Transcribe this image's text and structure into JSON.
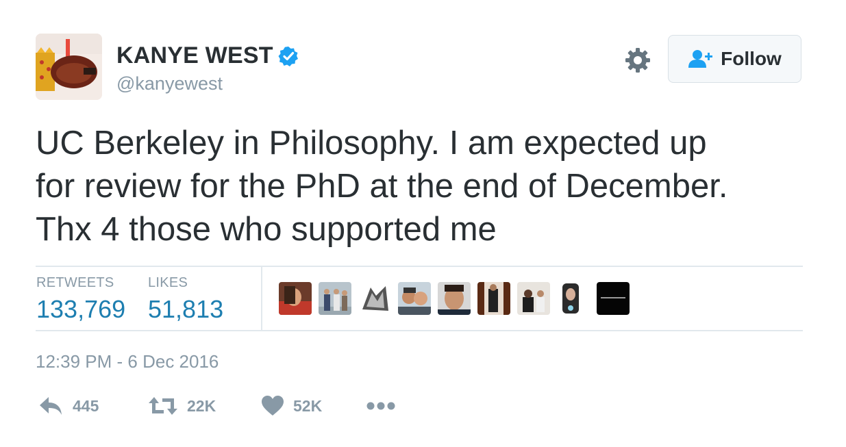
{
  "user": {
    "name": "KANYE WEST",
    "handle": "@kanyewest"
  },
  "header": {
    "follow_label": "Follow"
  },
  "tweet": {
    "lines": [
      "UC Berkeley in Philosophy. I am expected up",
      "for review for the PhD at the end of December.",
      "Thx 4 those who supported me"
    ]
  },
  "stats": {
    "retweets_label": "RETWEETS",
    "retweets_value": "133,769",
    "likes_label": "LIKES",
    "likes_value": "51,813"
  },
  "timestamp": "12:39 PM - 6 Dec 2016",
  "actions": {
    "reply_count": "445",
    "retweet_count": "22K",
    "like_count": "52K"
  },
  "colors": {
    "verified": "#1da1f2",
    "link_blue": "#1d7eb0",
    "muted": "#8899a6",
    "text": "#292f33"
  }
}
